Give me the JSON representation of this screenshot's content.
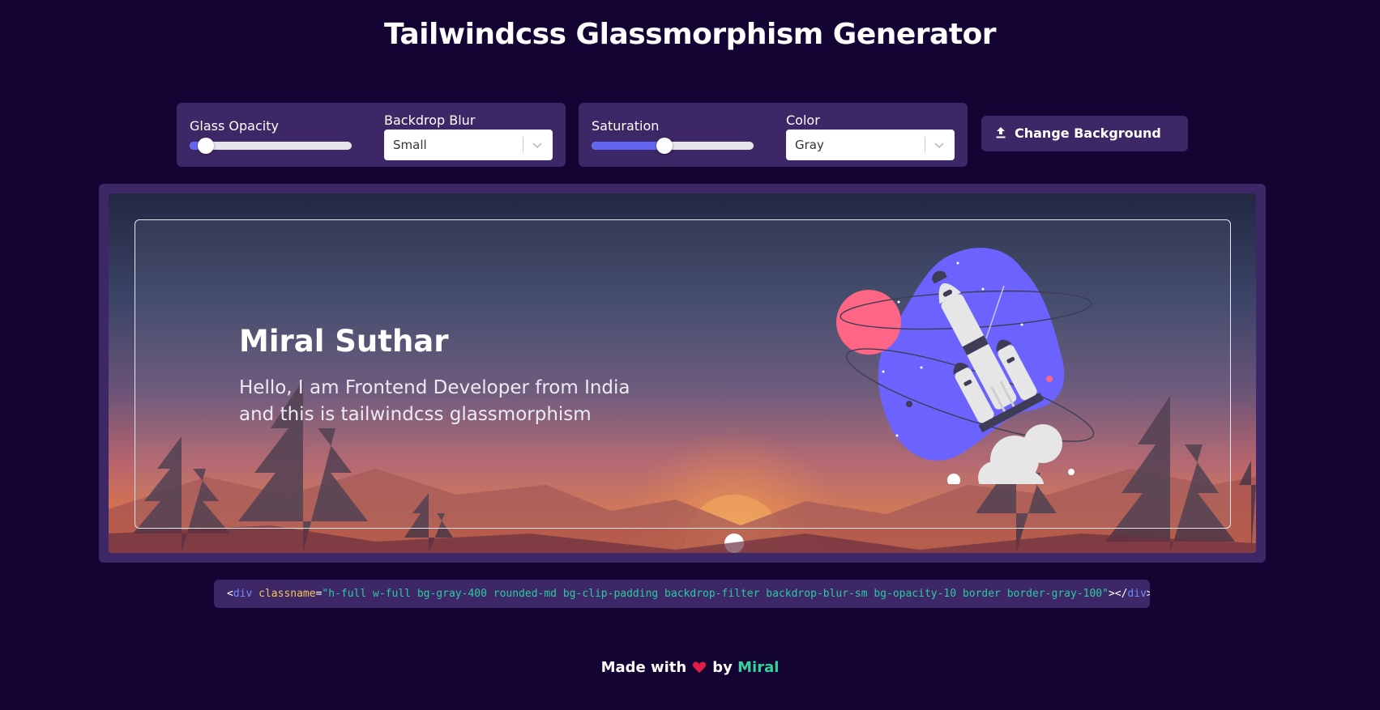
{
  "page": {
    "title": "Tailwindcss Glassmorphism Generator"
  },
  "controls": {
    "glass_opacity": {
      "label": "Glass Opacity",
      "value_percent": 10
    },
    "backdrop_blur": {
      "label": "Backdrop Blur",
      "value": "Small"
    },
    "saturation": {
      "label": "Saturation",
      "value_percent": 45
    },
    "color": {
      "label": "Color",
      "value": "Gray"
    },
    "change_background": {
      "label": "Change Background",
      "icon": "upload-icon"
    }
  },
  "preview": {
    "name": "Miral Suthar",
    "intro_line1": "Hello, I am Frontend Developer from India",
    "intro_line2": "and this is tailwindcss glassmorphism",
    "illustration": "rocket-illustration"
  },
  "code": {
    "open_lt": "<",
    "tag": "div",
    "attr": "classname",
    "eq": "=",
    "value": "\"h-full w-full bg-gray-400 rounded-md bg-clip-padding backdrop-filter backdrop-blur-sm bg-opacity-10 border border-gray-100\"",
    "close_gt": ">",
    "close_open": "</",
    "close_tag": "div",
    "close_end": ">"
  },
  "footer": {
    "made_with": "Made with",
    "by": "by",
    "author": "Miral"
  },
  "colors": {
    "page_bg": "#140434",
    "panel": "#3d2766",
    "accent": "#6366f1",
    "author": "#34d399",
    "heart": "#e11d48"
  }
}
